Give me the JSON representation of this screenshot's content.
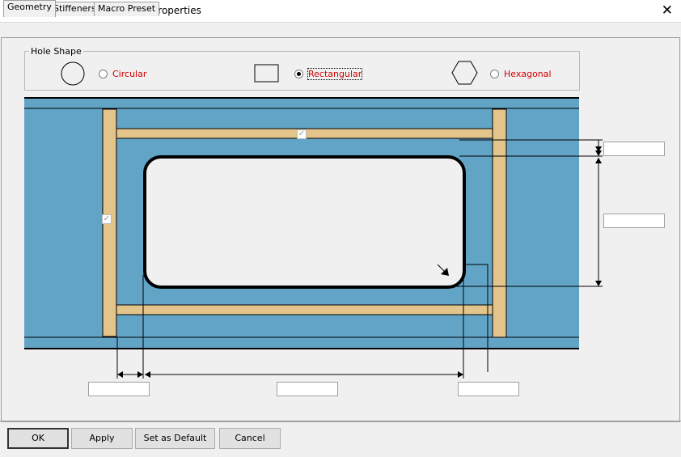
{
  "window": {
    "title": "Stiffened Web Opening Macro Properties",
    "close_symbol": "✕"
  },
  "tabs": [
    {
      "label": "Geometry",
      "active": true
    },
    {
      "label": "Stiffeners",
      "active": false
    },
    {
      "label": "Macro Preset",
      "active": false
    }
  ],
  "hole_shape": {
    "legend": "Hole Shape",
    "options": [
      {
        "label": "Circular",
        "selected": false
      },
      {
        "label": "Rectangular",
        "selected": true
      },
      {
        "label": "Hexagonal",
        "selected": false
      }
    ]
  },
  "diagram": {
    "web_color": "#62a4c6",
    "stiffener_color": "#e3c48a",
    "hole_color": "#f0f0f0",
    "check_mark": "✓"
  },
  "dimension_inputs": [
    {
      "name": "top-offset-input",
      "value": ""
    },
    {
      "name": "hole-height-input",
      "value": ""
    },
    {
      "name": "stiffener-offset-input",
      "value": ""
    },
    {
      "name": "hole-width-input",
      "value": ""
    },
    {
      "name": "corner-radius-input",
      "value": ""
    }
  ],
  "buttons": {
    "ok": "OK",
    "apply": "Apply",
    "default": "Set as Default",
    "cancel": "Cancel"
  }
}
